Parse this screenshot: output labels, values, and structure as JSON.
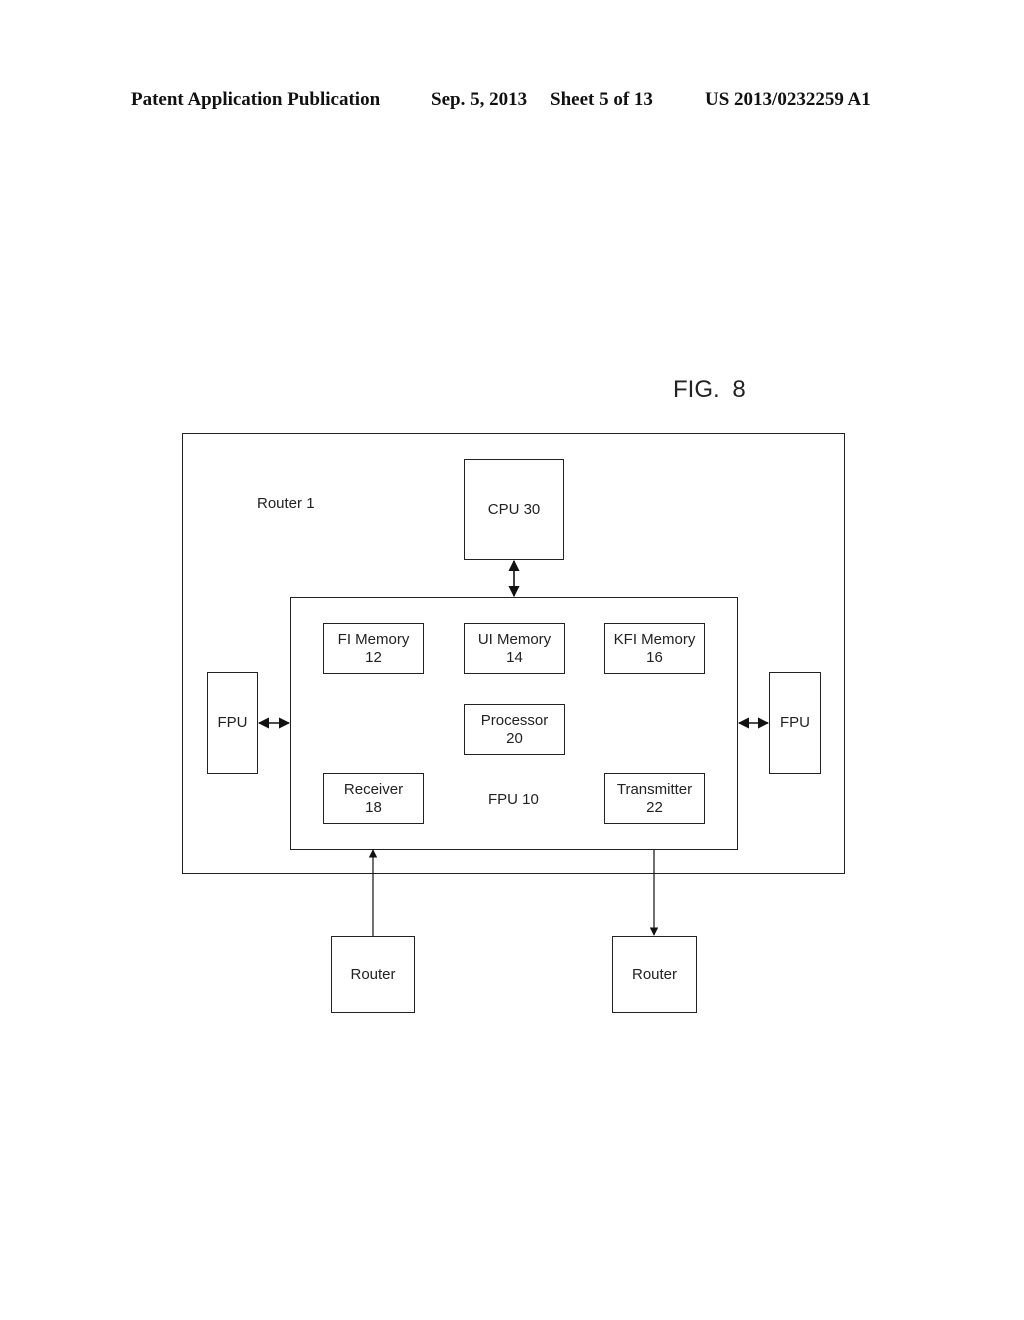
{
  "header": {
    "publication_type": "Patent Application Publication",
    "date": "Sep. 5, 2013",
    "sheet": "Sheet 5 of 13",
    "number": "US 2013/0232259 A1"
  },
  "figure": {
    "label": "FIG. 8",
    "router_outer_label": "Router 1",
    "cpu_label": "CPU 30",
    "fpu_main_label": "FPU 10",
    "fi_memory": {
      "name": "FI Memory",
      "ref": "12"
    },
    "ui_memory": {
      "name": "UI Memory",
      "ref": "14"
    },
    "kfi_memory": {
      "name": "KFI Memory",
      "ref": "16"
    },
    "processor": {
      "name": "Processor",
      "ref": "20"
    },
    "receiver": {
      "name": "Receiver",
      "ref": "18"
    },
    "transmitter": {
      "name": "Transmitter",
      "ref": "22"
    },
    "fpu_left_label": "FPU",
    "fpu_right_label": "FPU",
    "router_in_label": "Router",
    "router_out_label": "Router",
    "connections": [
      {
        "from": "CPU 30",
        "to": "FPU 10",
        "direction": "bidirectional"
      },
      {
        "from": "FPU (left)",
        "to": "FPU 10",
        "direction": "bidirectional"
      },
      {
        "from": "FPU 10",
        "to": "FPU (right)",
        "direction": "bidirectional"
      },
      {
        "from": "Router (in)",
        "to": "Receiver 18",
        "direction": "forward"
      },
      {
        "from": "Transmitter 22",
        "to": "Router (out)",
        "direction": "forward"
      }
    ]
  }
}
